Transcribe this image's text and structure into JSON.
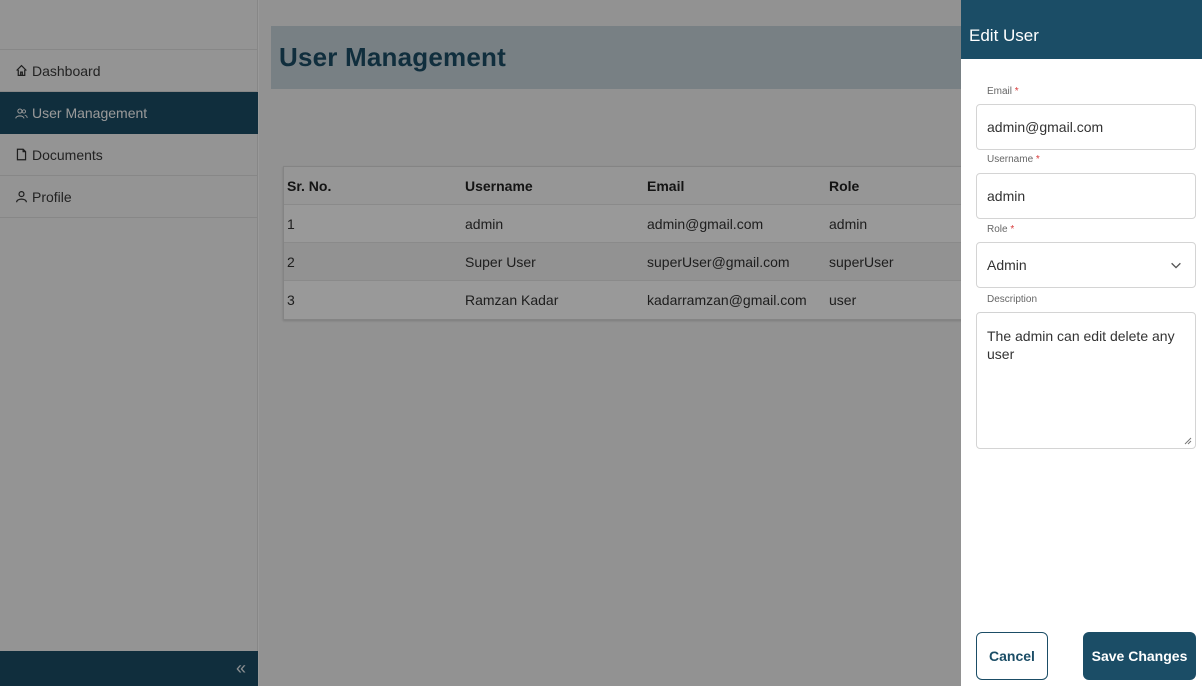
{
  "sidebar": {
    "items": [
      {
        "label": "Dashboard",
        "icon": "home-icon"
      },
      {
        "label": "User Management",
        "icon": "users-icon"
      },
      {
        "label": "Documents",
        "icon": "document-icon"
      },
      {
        "label": "Profile",
        "icon": "user-icon"
      }
    ],
    "active_item": "User Management",
    "collapse_label": "«"
  },
  "main": {
    "title": "User Management",
    "table": {
      "columns": [
        "Sr. No.",
        "Username",
        "Email",
        "Role"
      ],
      "rows": [
        [
          "1",
          "admin",
          "admin@gmail.com",
          "admin"
        ],
        [
          "2",
          "Super User",
          "superUser@gmail.com",
          "superUser"
        ],
        [
          "3",
          "Ramzan Kadar",
          "kadarramzan@gmail.com",
          "user"
        ]
      ]
    }
  },
  "drawer": {
    "title": "Edit User",
    "email": {
      "label": "Email",
      "required": "*",
      "value": "admin@gmail.com"
    },
    "username": {
      "label": "Username",
      "required": "*",
      "value": "admin"
    },
    "role": {
      "label": "Role",
      "required": "*",
      "value": "Admin"
    },
    "description": {
      "label": "Description",
      "value": "The admin can edit delete any user"
    },
    "cancel_label": "Cancel",
    "save_label": "Save Changes"
  },
  "colors": {
    "primary": "#1b4d66",
    "header_bg": "#c9d5dc",
    "required": "#d83a3a"
  }
}
